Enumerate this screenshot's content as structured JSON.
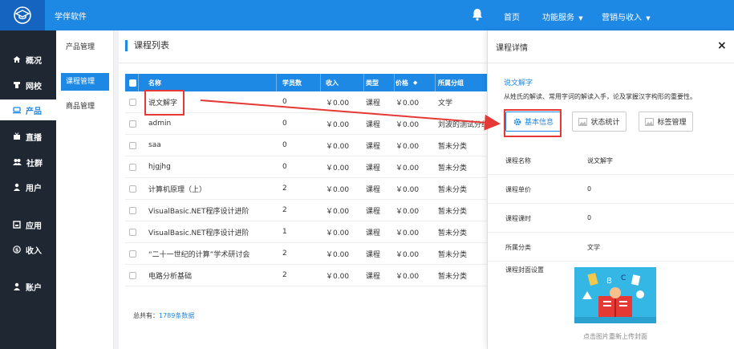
{
  "header": {
    "app_name": "学伴软件",
    "nav": [
      "首页",
      "功能服务",
      "营销与收入"
    ]
  },
  "sidebar": {
    "items": [
      {
        "label": "概况",
        "icon": "home-icon"
      },
      {
        "label": "网校",
        "icon": "school-icon"
      },
      {
        "label": "产品",
        "icon": "product-icon",
        "active": true
      },
      {
        "label": "直播",
        "icon": "live-icon"
      },
      {
        "label": "社群",
        "icon": "community-icon"
      },
      {
        "label": "用户",
        "icon": "user-icon"
      },
      {
        "label": "应用",
        "icon": "app-icon"
      },
      {
        "label": "收入",
        "icon": "income-icon"
      },
      {
        "label": "账户",
        "icon": "account-icon"
      }
    ]
  },
  "subnav": {
    "title": "产品管理",
    "items": [
      "课程管理",
      "商品管理"
    ]
  },
  "main": {
    "title": "课程列表",
    "columns": [
      "名称",
      "学员数",
      "收入",
      "类型",
      "价格",
      "所属分组"
    ],
    "rows": [
      {
        "name": "说文解字",
        "students": "0",
        "income": "￥0.00",
        "type": "课程",
        "price": "￥0.00",
        "group": "文学"
      },
      {
        "name": "admin",
        "students": "0",
        "income": "￥0.00",
        "type": "课程",
        "price": "￥0.00",
        "group": "刘波的测试分组"
      },
      {
        "name": "saa",
        "students": "0",
        "income": "￥0.00",
        "type": "课程",
        "price": "￥0.00",
        "group": "暂未分类"
      },
      {
        "name": "hjgjhg",
        "students": "0",
        "income": "￥0.00",
        "type": "课程",
        "price": "￥0.00",
        "group": "暂未分类"
      },
      {
        "name": "计算机原理（上）",
        "students": "2",
        "income": "￥0.00",
        "type": "课程",
        "price": "￥0.00",
        "group": "暂未分类"
      },
      {
        "name": "VisualBasic.NET程序设计进阶",
        "students": "2",
        "income": "￥0.00",
        "type": "课程",
        "price": "￥0.00",
        "group": "暂未分类"
      },
      {
        "name": "VisualBasic.NET程序设计进阶",
        "students": "1",
        "income": "￥0.00",
        "type": "课程",
        "price": "￥0.00",
        "group": "暂未分类"
      },
      {
        "name": "“二十一世纪的计算”学术研讨会",
        "students": "2",
        "income": "￥0.00",
        "type": "课程",
        "price": "￥0.00",
        "group": "暂未分类"
      },
      {
        "name": "电路分析基础",
        "students": "2",
        "income": "￥0.00",
        "type": "课程",
        "price": "￥0.00",
        "group": "暂未分类"
      }
    ],
    "total_prefix": "总共有：",
    "total_count": "1789条数据"
  },
  "detail": {
    "title": "课程详情",
    "course_name": "说文解字",
    "description": "从姓氏的解读、常用字词的解读入手，论及掌握汉字构形的重要性。",
    "buttons": [
      "基本信息",
      "状态统计",
      "标签管理"
    ],
    "fields": [
      {
        "label": "课程名称",
        "value": "说文解字"
      },
      {
        "label": "课程单价",
        "value": "0"
      },
      {
        "label": "课程课时",
        "value": "0"
      },
      {
        "label": "所属分类",
        "value": "文学"
      }
    ],
    "cover_label": "课程封面设置",
    "cover_hint": "点击图片重新上传封面",
    "close_symbol": "×"
  },
  "colors": {
    "primary": "#1e88e5",
    "sidebar_bg": "#1f2733",
    "annotation": "#e53935"
  }
}
